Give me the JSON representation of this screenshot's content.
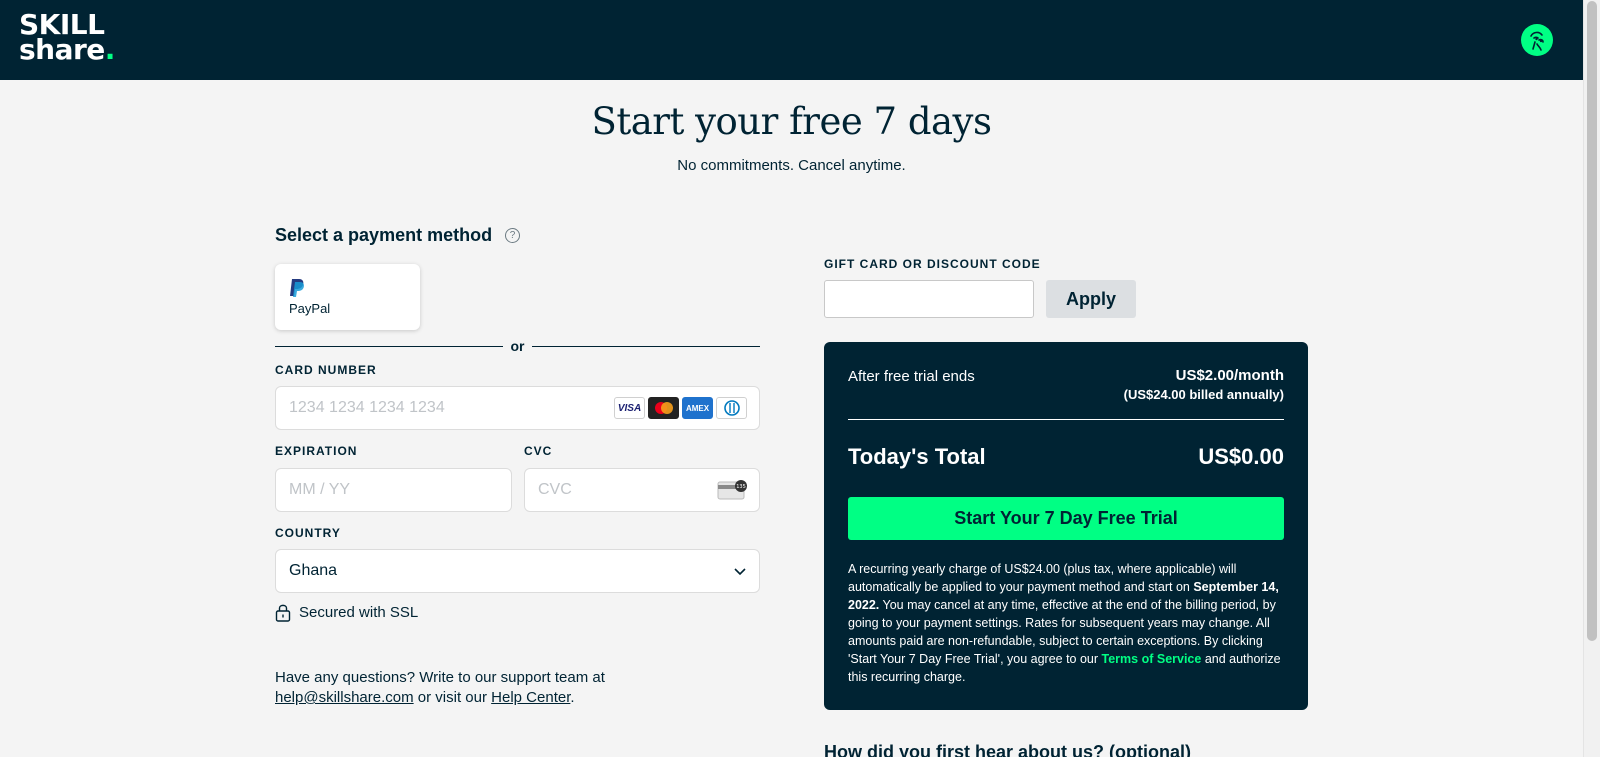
{
  "header": {
    "logo_line1": "SKILL",
    "logo_line2": "share",
    "logo_dot": "."
  },
  "hero": {
    "title": "Start your free 7 days",
    "subtitle": "No commitments. Cancel anytime."
  },
  "payment": {
    "heading": "Select a payment method",
    "help_icon": "?",
    "paypal_label": "PayPal",
    "or_text": "or",
    "card_number_label": "CARD NUMBER",
    "card_number_placeholder": "1234 1234 1234 1234",
    "card_brands": [
      "VISA",
      "mastercard",
      "AMEX",
      "diners"
    ],
    "expiration_label": "EXPIRATION",
    "expiration_placeholder": "MM / YY",
    "cvc_label": "CVC",
    "cvc_placeholder": "CVC",
    "cvc_icon_text": "135",
    "country_label": "COUNTRY",
    "country_value": "Ghana",
    "ssl_text": "Secured with SSL"
  },
  "support": {
    "line1": "Have any questions? Write to our support team at",
    "email": "help@skillshare.com",
    "middle": " or visit our ",
    "help_center": "Help Center",
    "end": "."
  },
  "gift": {
    "label": "GIFT CARD OR DISCOUNT CODE",
    "value": "",
    "apply_label": "Apply"
  },
  "summary": {
    "after_label": "After free trial ends",
    "after_price": "US$2.00/month",
    "after_annual": "(US$24.00 billed annually)",
    "today_label": "Today's Total",
    "today_value": "US$0.00",
    "cta_label": "Start Your 7 Day Free Trial",
    "legal_part1": "A recurring yearly charge of US$24.00 (plus tax, where applicable) will automatically be applied to your payment method and start on ",
    "legal_date": "September 14, 2022.",
    "legal_part2": " You may cancel at any time, effective at the end of the billing period, by going to your payment settings. Rates for subsequent years may change. All amounts paid are non-refundable, subject to certain exceptions. By clicking 'Start Your 7 Day Free Trial', you agree to our ",
    "legal_tos": "Terms of Service",
    "legal_part3": " and authorize this recurring charge."
  },
  "survey": {
    "heading": "How did you first hear about us? (optional)"
  },
  "colors": {
    "navy": "#002333",
    "accent_green": "#00ff84",
    "background": "#f4f4f4"
  }
}
